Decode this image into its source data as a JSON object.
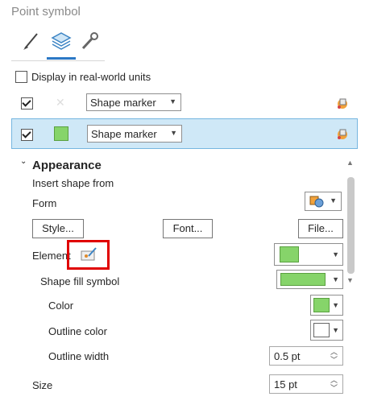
{
  "panel": {
    "title": "Point symbol"
  },
  "tabs": [
    {
      "icon": "brush-icon",
      "selected": false
    },
    {
      "icon": "layers-icon",
      "selected": true
    },
    {
      "icon": "wrench-icon",
      "selected": false
    }
  ],
  "realworld": {
    "label": "Display in real-world units",
    "checked": false
  },
  "layers": [
    {
      "checked": true,
      "shape": "Shape marker",
      "swatch_color": "#ffffff",
      "selected": false
    },
    {
      "checked": true,
      "shape": "Shape marker",
      "swatch_color": "#86d46a",
      "selected": true
    }
  ],
  "appearance": {
    "header": "Appearance",
    "insert_shape_label": "Insert shape from",
    "form_label": "Form",
    "buttons": {
      "style": "Style...",
      "font": "Font...",
      "file": "File..."
    },
    "element_label": "Element",
    "shape_fill_label": "Shape fill symbol",
    "color_label": "Color",
    "outline_color_label": "Outline color",
    "outline_width_label": "Outline width",
    "outline_width_value": "0.5 pt",
    "size_label": "Size",
    "size_value": "15 pt"
  },
  "colors": {
    "accent": "#2b78c5",
    "fill_green": "#86d46a",
    "selection": "#cfe8f7",
    "highlight": "#e00000"
  }
}
